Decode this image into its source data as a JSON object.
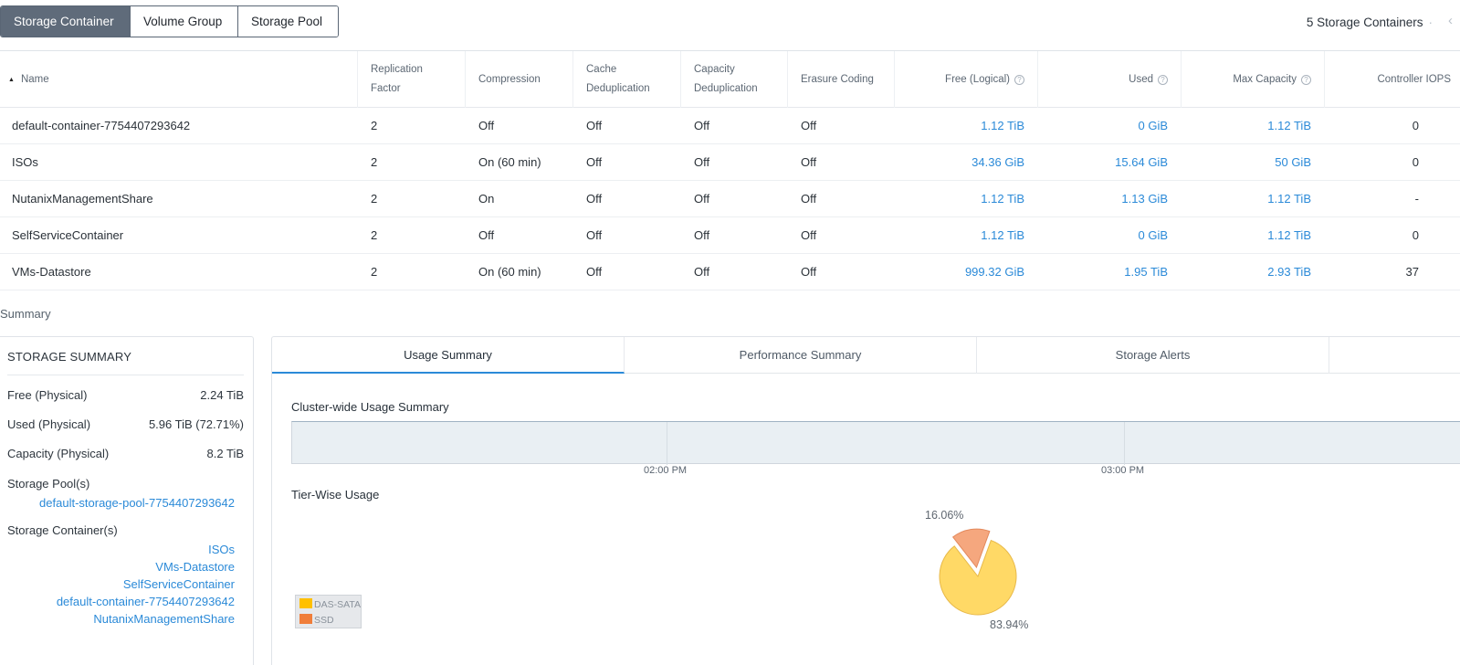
{
  "top_tabs": [
    "Storage Container",
    "Volume Group",
    "Storage Pool"
  ],
  "container_count": "5 Storage Containers",
  "table": {
    "headers": {
      "name": "Name",
      "replication_line1": "Replication",
      "replication_line2": "Factor",
      "compression": "Compression",
      "cache_line1": "Cache",
      "cache_line2": "Deduplication",
      "capacity_line1": "Capacity",
      "capacity_line2": "Deduplication",
      "erasure": "Erasure Coding",
      "free": "Free (Logical)",
      "used": "Used",
      "max": "Max Capacity",
      "iops": "Controller IOPS"
    },
    "rows": [
      {
        "name": "default-container-7754407293642",
        "rf": "2",
        "compression": "Off",
        "cache": "Off",
        "capdedup": "Off",
        "erasure": "Off",
        "free": "1.12 TiB",
        "used": "0 GiB",
        "max": "1.12 TiB",
        "iops": "0"
      },
      {
        "name": "ISOs",
        "rf": "2",
        "compression": "On  (60 min)",
        "cache": "Off",
        "capdedup": "Off",
        "erasure": "Off",
        "free": "34.36 GiB",
        "used": "15.64 GiB",
        "max": "50 GiB",
        "iops": "0"
      },
      {
        "name": "NutanixManagementShare",
        "rf": "2",
        "compression": "On",
        "cache": "Off",
        "capdedup": "Off",
        "erasure": "Off",
        "free": "1.12 TiB",
        "used": "1.13 GiB",
        "max": "1.12 TiB",
        "iops": "-"
      },
      {
        "name": "SelfServiceContainer",
        "rf": "2",
        "compression": "Off",
        "cache": "Off",
        "capdedup": "Off",
        "erasure": "Off",
        "free": "1.12 TiB",
        "used": "0 GiB",
        "max": "1.12 TiB",
        "iops": "0"
      },
      {
        "name": "VMs-Datastore",
        "rf": "2",
        "compression": "On  (60 min)",
        "cache": "Off",
        "capdedup": "Off",
        "erasure": "Off",
        "free": "999.32 GiB",
        "used": "1.95 TiB",
        "max": "2.93 TiB",
        "iops": "37"
      }
    ]
  },
  "summary_label": "Summary",
  "storage_summary": {
    "title": "STORAGE SUMMARY",
    "free_label": "Free (Physical)",
    "free_value": "2.24 TiB",
    "used_label": "Used (Physical)",
    "used_value": "5.96 TiB (72.71%)",
    "capacity_label": "Capacity (Physical)",
    "capacity_value": "8.2 TiB",
    "pools_label": "Storage Pool(s)",
    "pools": [
      "default-storage-pool-7754407293642"
    ],
    "containers_label": "Storage Container(s)",
    "containers": [
      "ISOs",
      "VMs-Datastore",
      "SelfServiceContainer",
      "default-container-7754407293642",
      "NutanixManagementShare"
    ]
  },
  "panel_tabs": [
    "Usage Summary",
    "Performance Summary",
    "Storage Alerts"
  ],
  "usage": {
    "cluster_title": "Cluster-wide Usage Summary",
    "time_labels": [
      "02:00 PM",
      "03:00 PM"
    ],
    "tier_title": "Tier-Wise Usage"
  },
  "chart_data": {
    "type": "pie",
    "series": [
      {
        "name": "DAS-SATA",
        "value": 83.94,
        "label": "83.94%",
        "color": "#ffd966"
      },
      {
        "name": "SSD",
        "value": 16.06,
        "label": "16.06%",
        "color": "#f5a77e"
      }
    ],
    "legend": [
      {
        "name": "DAS-SATA",
        "color": "#ffc000"
      },
      {
        "name": "SSD",
        "color": "#f07e3a"
      }
    ]
  }
}
